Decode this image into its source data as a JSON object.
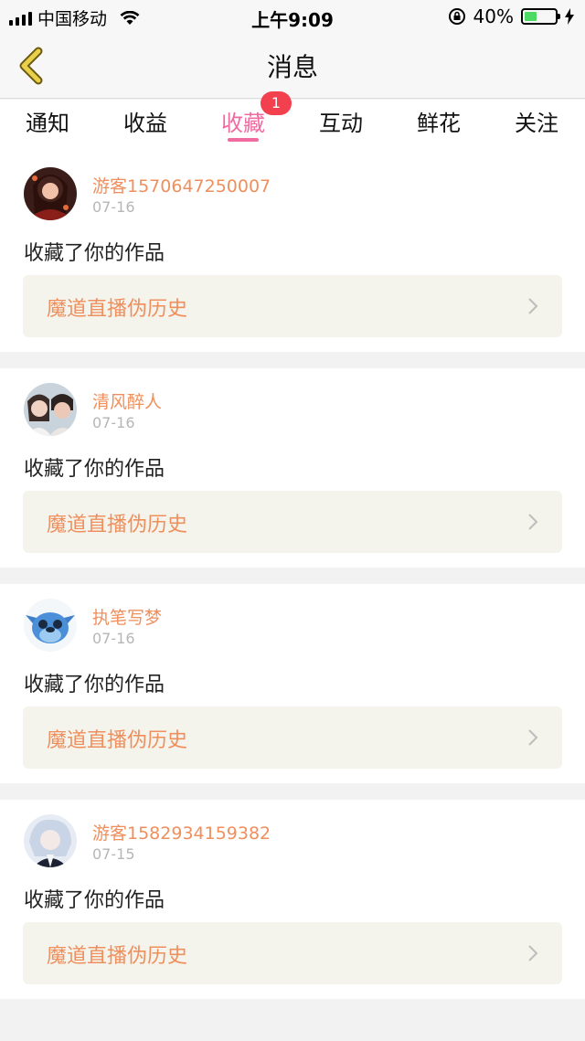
{
  "status_bar": {
    "carrier": "中国移动",
    "time": "上午9:09",
    "battery_text": "40%",
    "battery_level": 0.4
  },
  "navbar": {
    "title": "消息",
    "back_icon": "chevron-left-icon"
  },
  "tabs": [
    {
      "label": "通知"
    },
    {
      "label": "收益"
    },
    {
      "label": "收藏",
      "active": true,
      "badge": "1"
    },
    {
      "label": "互动"
    },
    {
      "label": "鲜花"
    },
    {
      "label": "关注"
    }
  ],
  "items": [
    {
      "username": "游客1570647250007",
      "date": "07-16",
      "action": "收藏了你的作品",
      "work_title": "魔道直播伪历史"
    },
    {
      "username": "清风醉人",
      "date": "07-16",
      "action": "收藏了你的作品",
      "work_title": "魔道直播伪历史"
    },
    {
      "username": "执笔写梦",
      "date": "07-16",
      "action": "收藏了你的作品",
      "work_title": "魔道直播伪历史"
    },
    {
      "username": "游客1582934159382",
      "date": "07-15",
      "action": "收藏了你的作品",
      "work_title": "魔道直播伪历史"
    }
  ],
  "colors": {
    "accent_pink": "#f06ba0",
    "orange_text": "#ef8f5d",
    "badge_red": "#f2404e",
    "back_arrow": "#e8d04a"
  }
}
